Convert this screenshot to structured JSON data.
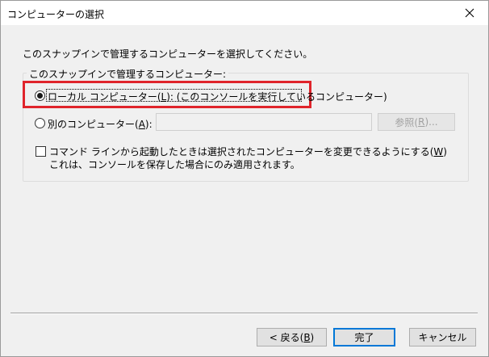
{
  "window": {
    "title": "コンピューターの選択"
  },
  "intro_text": "このスナップインで管理するコンピューターを選択してください。",
  "group": {
    "label": "このスナップインで管理するコンピューター:",
    "local_option": {
      "label_prefix": "ローカル コンピューター(",
      "accel": "L",
      "label_suffix": "): (このコンソールを実行しているコンピューター)",
      "selected": true
    },
    "other_option": {
      "label_prefix": "別のコンピューター(",
      "accel": "A",
      "label_suffix": "):",
      "selected": false,
      "input_value": ""
    },
    "browse_button": {
      "label_prefix": "参照(",
      "accel": "R",
      "label_suffix": ")..."
    },
    "allow_change_checkbox": {
      "line1_prefix": "コマンド ラインから起動したときは選択されたコンピューターを変更できるようにする(",
      "accel": "W",
      "line1_suffix": ")",
      "line2": "これは、コンソールを保存した場合にのみ適用されます。",
      "checked": false
    }
  },
  "buttons": {
    "back": {
      "prefix": "< 戻る(",
      "accel": "B",
      "suffix": ")"
    },
    "finish": "完了",
    "cancel": "キャンセル"
  },
  "colors": {
    "highlight_box": "#e0242b",
    "default_button_border": "#0078d7"
  }
}
